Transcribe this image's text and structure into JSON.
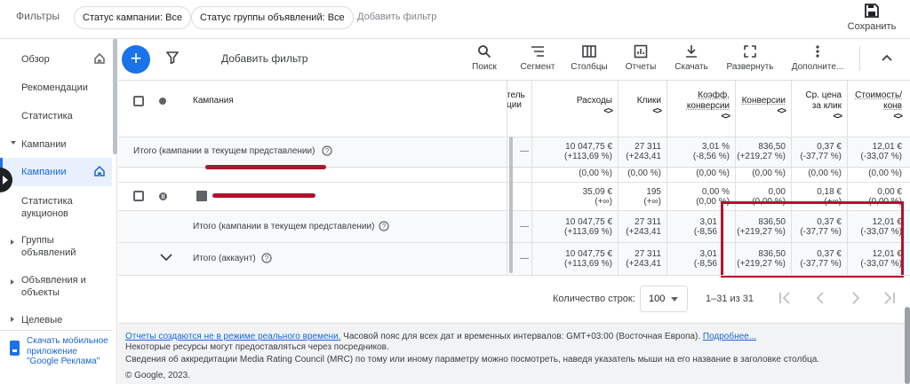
{
  "topbar": {
    "filters_label": "Фильтры",
    "chips": [
      "Статус кампании: Все",
      "Статус группы объявлений: Все"
    ],
    "add_filter": "Добавить фильтр",
    "save_label": "Сохранить"
  },
  "sidebar": {
    "items": [
      {
        "label": "Обзор"
      },
      {
        "label": "Рекомендации"
      },
      {
        "label": "Статистика"
      },
      {
        "label": "Кампании"
      },
      {
        "label": "Кампании"
      },
      {
        "label": "Статистика аукционов"
      },
      {
        "label": "Группы объявлений"
      },
      {
        "label": "Объявления и объекты"
      },
      {
        "label": "Целевые"
      }
    ],
    "download_app": "Скачать мобильное приложение \"Google Реклама\""
  },
  "toolbar": {
    "add_filter": "Добавить фильтр",
    "tools": [
      {
        "label": "Поиск",
        "icon": "search-icon"
      },
      {
        "label": "Сегмент",
        "icon": "segment-icon"
      },
      {
        "label": "Столбцы",
        "icon": "columns-icon"
      },
      {
        "label": "Отчеты",
        "icon": "reports-icon"
      },
      {
        "label": "Скачать",
        "icon": "download-icon"
      },
      {
        "label": "Развернуть",
        "icon": "expand-icon"
      },
      {
        "label": "Дополните...",
        "icon": "more-vert-icon"
      }
    ]
  },
  "table": {
    "headers": {
      "campaign": "Кампания",
      "cut_col": "тель\nции",
      "cost": "Расходы",
      "clicks": "Клики",
      "conv_rate": "Коэфф.\nконверсии",
      "conversions": "Конверсии",
      "avg_cpc": "Ср. цена\nза клик",
      "cost_conv": "Стоимость/\nконв",
      "sort_glyph": "<>"
    },
    "pinned_total": {
      "label": "Итого (кампании в текущем представлении)",
      "dash": "—",
      "cost": [
        "10 047,75 €",
        "(+113,69 %)"
      ],
      "clicks": [
        "27 311",
        "(+243,41"
      ],
      "conv_rate": [
        "3,01 %",
        "(-8,56 %)"
      ],
      "conversions": [
        "836,50",
        "(+219,27 %)"
      ],
      "avg_cpc": [
        "0,37 €",
        "(-37,77 %)"
      ],
      "cost_conv": [
        "12,01 €",
        "(-33,07 %)"
      ]
    },
    "partial_row": {
      "cost": "(0,00 %)",
      "clicks": "(0,00 %)",
      "conv_rate": "(0,00 %)",
      "conversions": "(0,00 %)",
      "avg_cpc": "(0,00 %)",
      "cost_conv": "(0,00 %)"
    },
    "campaign_row": {
      "cost": [
        "35,09 €",
        "(+∞)"
      ],
      "clicks": [
        "195",
        "(+∞)"
      ],
      "conv_rate": [
        "0,00 %",
        "(0,00 %)"
      ],
      "conversions": [
        "0,00",
        "(0,00 %)"
      ],
      "avg_cpc": [
        "0,18 €",
        "(+∞)"
      ],
      "cost_conv": [
        "0,00 €",
        "(0,00 %)"
      ]
    },
    "total_view": {
      "label": "Итого (кампании в текущем представлении)",
      "dash": "—",
      "cost": [
        "10 047,75 €",
        "(+113,69 %)"
      ],
      "clicks": [
        "27 311",
        "(+243,41"
      ],
      "conv_rate": [
        "3,01",
        "(-8,56"
      ],
      "conversions": [
        "836,50",
        "(+219,27 %)"
      ],
      "avg_cpc": [
        "0,37 €",
        "(-37,77 %)"
      ],
      "cost_conv": [
        "12,01 €",
        "(-33,07 %)"
      ]
    },
    "total_account": {
      "label": "Итого (аккаунт)",
      "dash": "—",
      "cost": [
        "10 047,75 €",
        "(+113,69 %)"
      ],
      "clicks": [
        "27 311",
        "(+243,41"
      ],
      "conv_rate": [
        "3,01",
        "(-8,56"
      ],
      "conversions": [
        "836,50",
        "(+219,27 %)"
      ],
      "avg_cpc": [
        "0,37 €",
        "(-37,77 %)"
      ],
      "cost_conv": [
        "12,01 €",
        "(-33,07 %)"
      ]
    }
  },
  "pager": {
    "rows_label": "Количество строк:",
    "rows_value": "100",
    "range": "1–31 из 31"
  },
  "footer": {
    "line1_link": "Отчеты создаются не в режиме реального времени.",
    "line1_text": " Часовой пояс для всех дат и временных интервалов: GMT+03:00 (Восточная Европа). ",
    "line1_more": "Подробнее...",
    "line2": "Некоторые ресурсы могут предоставляться через посредников.",
    "line3": "Сведения об аккредитации Media Rating Council (MRC) по тому или иному параметру можно посмотреть, наведя указатель мыши на его название в заголовке столбца.",
    "line4": "© Google, 2023."
  },
  "colors": {
    "accent": "#1a73e8",
    "highlight_box": "#b3122e"
  }
}
